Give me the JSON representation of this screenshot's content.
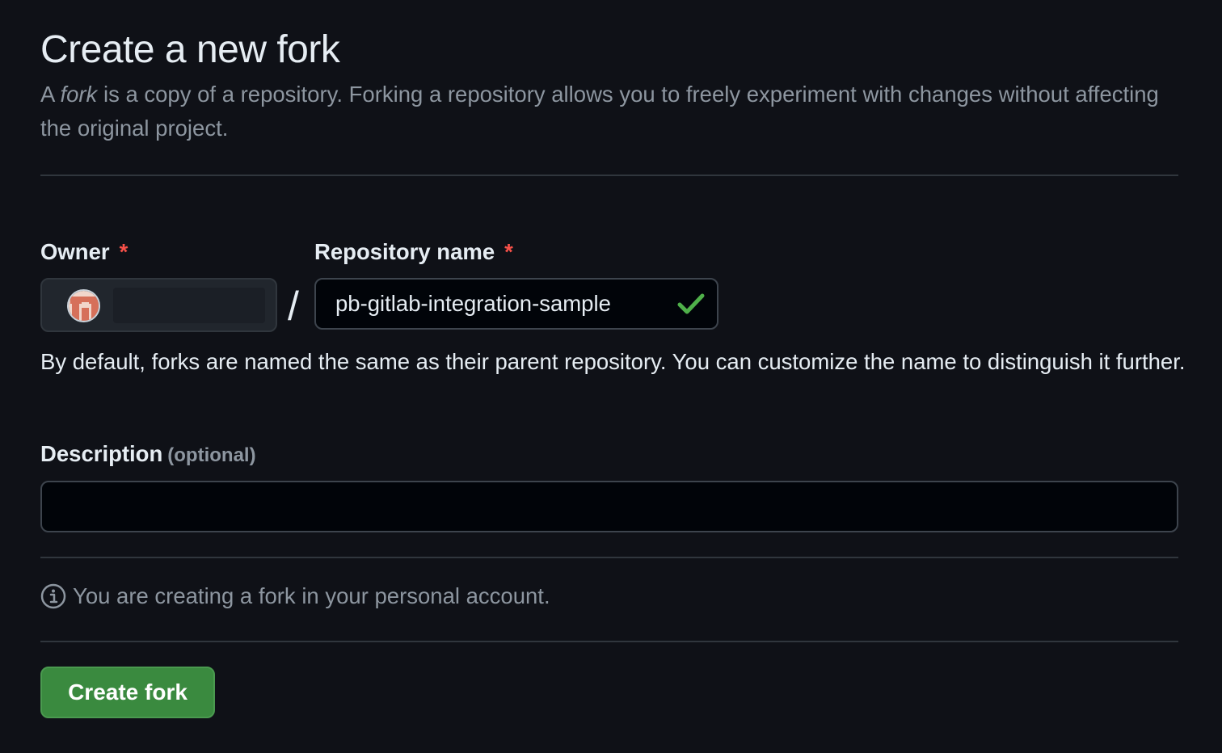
{
  "header": {
    "title": "Create a new fork",
    "intro_prefix": "A ",
    "intro_em": "fork",
    "intro_suffix": " is a copy of a repository. Forking a repository allows you to freely experiment with changes without affecting the original project."
  },
  "owner": {
    "label": "Owner",
    "required_mark": "*",
    "avatar_icon": "user-avatar"
  },
  "separator": "/",
  "repository": {
    "label": "Repository name",
    "required_mark": "*",
    "value": "pb-gitlab-integration-sample",
    "status_icon": "check-icon"
  },
  "help_text": "By default, forks are named the same as their parent repository. You can customize the name to distinguish it further.",
  "description": {
    "label": "Description",
    "optional": "(optional)",
    "value": ""
  },
  "info": {
    "icon": "info-icon",
    "text": "You are creating a fork in your personal account."
  },
  "submit_label": "Create fork",
  "colors": {
    "background": "#0f1117",
    "primary_button": "#3a8a3f",
    "required": "#f85149",
    "check": "#4fb04a",
    "muted_text": "#8d96a0"
  }
}
